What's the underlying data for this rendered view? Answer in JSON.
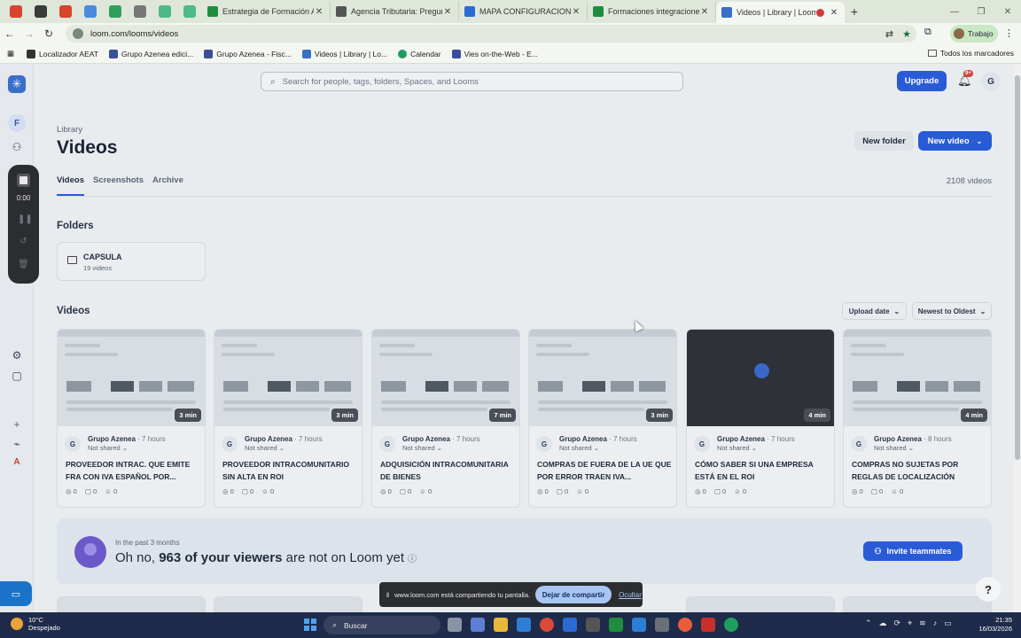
{
  "browser": {
    "tabs": [
      {
        "title": "Estrategia de Formación AZENE",
        "color": "#1e8e3e"
      },
      {
        "title": "Agencia Tributaria: Preguntas fr",
        "color": "#555555"
      },
      {
        "title": "MAPA CONFIGURACION EXCEL",
        "color": "#2a6bd6"
      },
      {
        "title": "Formaciones integraciones - Ho",
        "color": "#1e8e3e"
      },
      {
        "title": "Videos | Library | Loom",
        "color": "#3a6fc9"
      }
    ],
    "url": "loom.com/looms/videos",
    "profile_label": "Trabajo",
    "bookmarks": [
      {
        "label": "Localizador AEAT",
        "color": "#333333"
      },
      {
        "label": "Grupo Azenea edici...",
        "color": "#3a4f9a"
      },
      {
        "label": "Grupo Azenea - Fisc...",
        "color": "#3a4f9a"
      },
      {
        "label": "Videos | Library | Lo...",
        "color": "#3a6fc9"
      },
      {
        "label": "Calendar",
        "color": "#1e9e5e"
      },
      {
        "label": "Vies on-the-Web - E...",
        "color": "#3a4f9a"
      }
    ],
    "all_bookmarks": "Todos los marcadores"
  },
  "rail": {
    "workspace_initial": "F",
    "recorder_time": "0:00",
    "account_initial": "A"
  },
  "header": {
    "search_placeholder": "Search for people, tags, folders, Spaces, and Looms",
    "upgrade_label": "Upgrade",
    "notification_count": "9+",
    "user_initial": "G"
  },
  "page": {
    "breadcrumb": "Library",
    "title": "Videos",
    "new_folder_label": "New folder",
    "new_video_label": "New video",
    "tabs": [
      "Videos",
      "Screenshots",
      "Archive"
    ],
    "video_count": "2108 videos"
  },
  "folders": {
    "heading": "Folders",
    "items": [
      {
        "name": "CAPSULA",
        "count": "19 videos"
      }
    ]
  },
  "videos": {
    "heading": "Videos",
    "sort_field": "Upload date",
    "sort_order": "Newest to Oldest",
    "items": [
      {
        "duration": "3 min",
        "author": "Grupo Azenea",
        "time": "· 7 hours",
        "sharing": "Not shared",
        "title": "PROVEEDOR INTRAC. QUE EMITE FRA CON IVA ESPAÑOL POR...",
        "views": "0",
        "comments": "0",
        "reactions": "0"
      },
      {
        "duration": "3 min",
        "author": "Grupo Azenea",
        "time": "· 7 hours",
        "sharing": "Not shared",
        "title": "PROVEEDOR INTRACOMUNITARIO SIN ALTA EN ROI",
        "views": "0",
        "comments": "0",
        "reactions": "0"
      },
      {
        "duration": "7 min",
        "author": "Grupo Azenea",
        "time": "· 7 hours",
        "sharing": "Not shared",
        "title": "ADQUISICIÓN INTRACOMUNITARIA DE BIENES",
        "views": "0",
        "comments": "0",
        "reactions": "0"
      },
      {
        "duration": "3 min",
        "author": "Grupo Azenea",
        "time": "· 7 hours",
        "sharing": "Not shared",
        "title": "COMPRAS DE FUERA DE LA UE QUE POR ERROR TRAEN IVA...",
        "views": "0",
        "comments": "0",
        "reactions": "0"
      },
      {
        "duration": "4 min",
        "author": "Grupo Azenea",
        "time": "· 7 hours",
        "sharing": "Not shared",
        "title": "CÓMO SABER SI UNA EMPRESA ESTÁ EN EL ROI",
        "views": "0",
        "comments": "0",
        "reactions": "0"
      },
      {
        "duration": "4 min",
        "author": "Grupo Azenea",
        "time": "· 8 hours",
        "sharing": "Not shared",
        "title": "COMPRAS NO SUJETAS POR REGLAS DE LOCALIZACIÓN",
        "views": "0",
        "comments": "0",
        "reactions": "0"
      }
    ]
  },
  "banner": {
    "small": "In the past 3 months",
    "prefix": "Oh no, ",
    "highlight": "963 of your viewers",
    "suffix": " are not on Loom yet",
    "invite_label": "Invite teammates"
  },
  "share_bar": {
    "message": "www.loom.com está compartiendo tu pantalla.",
    "stop_label": "Dejar de compartir",
    "hide_label": "Ocultar"
  },
  "taskbar": {
    "temperature": "10°C",
    "weather": "Despejado",
    "search_label": "Buscar",
    "time": "21:35",
    "date": "16/03/2026"
  },
  "colors": {
    "accent": "#2a5bd7",
    "recorder": "#2b2d31"
  }
}
